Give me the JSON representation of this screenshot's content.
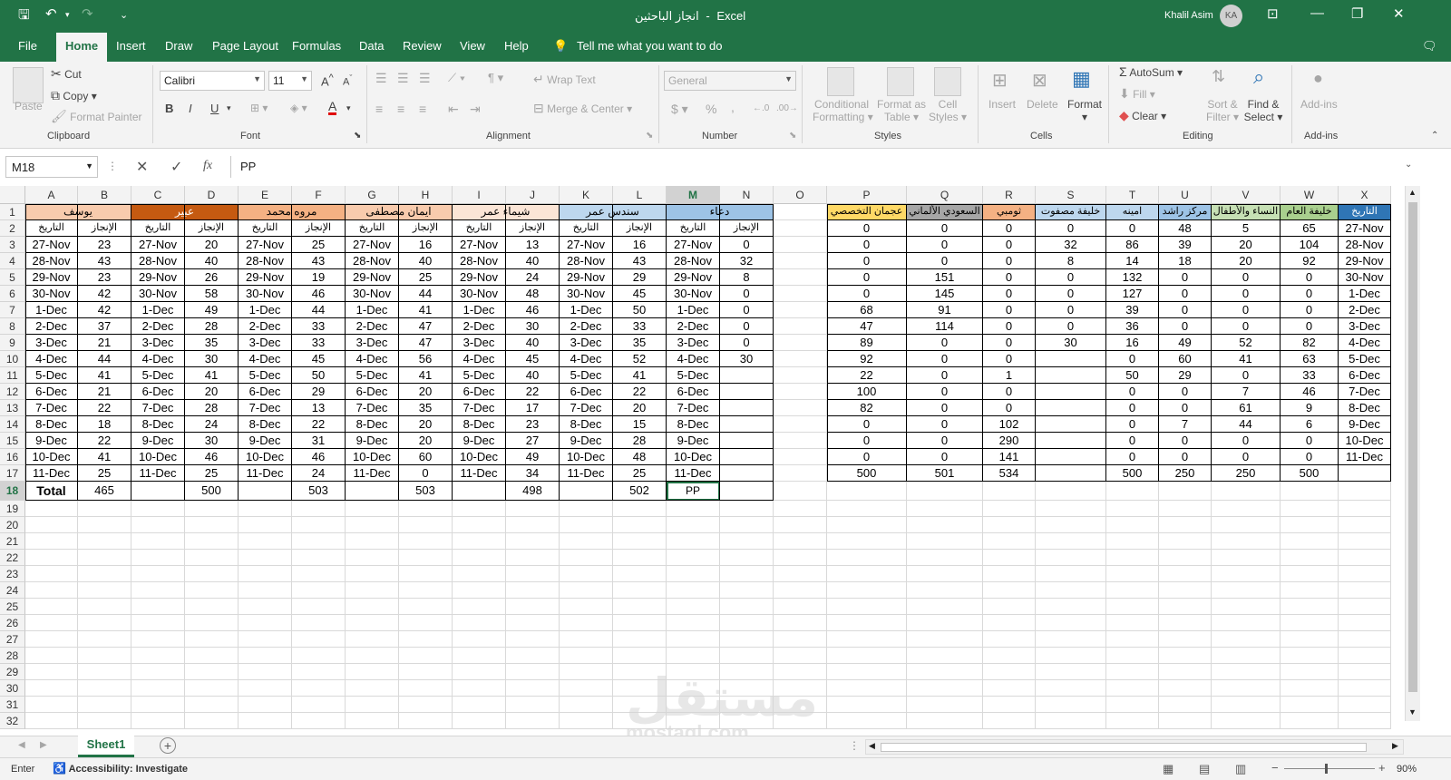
{
  "app": {
    "doc_title": "انجاز الباحثين",
    "separator": "-",
    "name": "Excel",
    "user_name": "Khalil Asim",
    "user_initials": "KA"
  },
  "tabs": [
    "File",
    "Home",
    "Insert",
    "Draw",
    "Page Layout",
    "Formulas",
    "Data",
    "Review",
    "View",
    "Help"
  ],
  "tell_me": "Tell me what you want to do",
  "ribbon": {
    "clipboard": {
      "paste": "Paste",
      "cut": "Cut",
      "copy": "Copy",
      "format_painter": "Format Painter",
      "label": "Clipboard"
    },
    "font": {
      "name": "Calibri",
      "size": "11",
      "bold": "B",
      "italic": "I",
      "underline": "U",
      "grow": "A",
      "shrink": "A",
      "color_a": "A",
      "label": "Font"
    },
    "alignment": {
      "wrap": "Wrap Text",
      "merge": "Merge & Center",
      "label": "Alignment"
    },
    "number": {
      "format": "General",
      "currency": "$",
      "percent": "%",
      "comma": ",",
      "label": "Number"
    },
    "styles": {
      "cond1": "Conditional",
      "cond2": "Formatting",
      "fmt1": "Format as",
      "fmt2": "Table",
      "cell1": "Cell",
      "cell2": "Styles",
      "label": "Styles"
    },
    "cells": {
      "insert": "Insert",
      "delete": "Delete",
      "format": "Format",
      "label": "Cells"
    },
    "editing": {
      "autosum": "AutoSum",
      "fill": "Fill",
      "clear": "Clear",
      "sort1": "Sort &",
      "sort2": "Filter",
      "find1": "Find &",
      "find2": "Select",
      "label": "Editing"
    },
    "addins": {
      "btn": "Add-ins",
      "label": "Add-ins"
    }
  },
  "formula": {
    "name_box": "M18",
    "fx": "fx",
    "content": "PP"
  },
  "sheet": {
    "columns": [
      "A",
      "B",
      "C",
      "D",
      "E",
      "F",
      "G",
      "H",
      "I",
      "J",
      "K",
      "L",
      "M",
      "N",
      "O",
      "P",
      "Q",
      "R",
      "S",
      "T",
      "U",
      "V",
      "W",
      "X"
    ],
    "rows": [
      "1",
      "2",
      "3",
      "4",
      "5",
      "6",
      "7",
      "8",
      "9",
      "10",
      "11",
      "12",
      "13",
      "14",
      "15",
      "16",
      "17",
      "18",
      "19",
      "20",
      "21",
      "22",
      "23",
      "24",
      "25",
      "26",
      "27",
      "28",
      "29",
      "30",
      "31",
      "32"
    ],
    "left_names": [
      "يوسف",
      "عبير",
      "مروه محمد",
      "ايمان مصطفى",
      "شيماء عمر",
      "سندس عمر",
      "دعاء"
    ],
    "left_name_colors": [
      "#f8cbad",
      "#c55a11",
      "#f4b183",
      "#f8cbad",
      "#fbe5d6",
      "#bdd7ee",
      "#9dc3e6"
    ],
    "sub_date": "التاريخ",
    "sub_ach": "الإنجاز",
    "dates": [
      "27-Nov",
      "28-Nov",
      "29-Nov",
      "30-Nov",
      "1-Dec",
      "2-Dec",
      "3-Dec",
      "4-Dec",
      "5-Dec",
      "6-Dec",
      "7-Dec",
      "8-Dec",
      "9-Dec",
      "10-Dec",
      "11-Dec"
    ],
    "left_values": [
      [
        "23",
        "43",
        "23",
        "42",
        "42",
        "37",
        "21",
        "44",
        "41",
        "21",
        "22",
        "18",
        "22",
        "41",
        "25"
      ],
      [
        "20",
        "40",
        "26",
        "58",
        "49",
        "28",
        "35",
        "30",
        "41",
        "20",
        "28",
        "24",
        "30",
        "46",
        "25"
      ],
      [
        "25",
        "43",
        "19",
        "46",
        "44",
        "33",
        "33",
        "45",
        "50",
        "29",
        "13",
        "22",
        "31",
        "46",
        "24"
      ],
      [
        "16",
        "40",
        "25",
        "44",
        "41",
        "47",
        "47",
        "56",
        "41",
        "20",
        "35",
        "20",
        "20",
        "60",
        "0"
      ],
      [
        "13",
        "40",
        "24",
        "48",
        "46",
        "30",
        "40",
        "45",
        "40",
        "22",
        "17",
        "23",
        "27",
        "49",
        "34"
      ],
      [
        "16",
        "43",
        "29",
        "45",
        "50",
        "33",
        "35",
        "52",
        "41",
        "22",
        "20",
        "15",
        "28",
        "48",
        "25"
      ],
      [
        "0",
        "32",
        "8",
        "0",
        "0",
        "0",
        "0",
        "30",
        "",
        "",
        "",
        "",
        "",
        "",
        ""
      ]
    ],
    "total_label": "Total",
    "totals": [
      "465",
      "500",
      "503",
      "503",
      "498",
      "502",
      "PP"
    ],
    "right_headers": [
      "عجمان التخصصي",
      "السعودي الألماني",
      "ثومبي",
      "خليفة مصفوت",
      "امينه",
      "مركز راشد",
      "النساء والأطفال",
      "خليفة العام",
      "التاريخ"
    ],
    "right_header_colors": [
      "#ffd966",
      "#a6a6a6",
      "#f4b183",
      "#bdd7ee",
      "#bdd7ee",
      "#9dc3e6",
      "#c6e0b4",
      "#a9d08e",
      "#2f75b5"
    ],
    "right_values": [
      [
        "0",
        "0",
        "0",
        "0",
        "0",
        "68",
        "47",
        "89",
        "92",
        "22",
        "100",
        "82",
        "0",
        "0",
        "0",
        "500"
      ],
      [
        "0",
        "0",
        "0",
        "151",
        "145",
        "91",
        "114",
        "0",
        "0",
        "0",
        "0",
        "0",
        "0",
        "0",
        "0",
        "501"
      ],
      [
        "0",
        "0",
        "0",
        "0",
        "0",
        "0",
        "0",
        "0",
        "0",
        "1",
        "0",
        "0",
        "102",
        "290",
        "141",
        "534"
      ],
      [
        "0",
        "32",
        "8",
        "0",
        "0",
        "0",
        "0",
        "30",
        "",
        "",
        "",
        "",
        "",
        "",
        "",
        ""
      ],
      [
        "0",
        "86",
        "14",
        "132",
        "127",
        "39",
        "36",
        "16",
        "0",
        "50",
        "0",
        "0",
        "0",
        "0",
        "0",
        "500"
      ],
      [
        "48",
        "39",
        "18",
        "0",
        "0",
        "0",
        "0",
        "49",
        "60",
        "29",
        "0",
        "0",
        "7",
        "0",
        "0",
        "250"
      ],
      [
        "5",
        "20",
        "20",
        "0",
        "0",
        "0",
        "0",
        "52",
        "41",
        "0",
        "7",
        "61",
        "44",
        "0",
        "0",
        "250"
      ],
      [
        "65",
        "104",
        "92",
        "0",
        "0",
        "0",
        "0",
        "82",
        "63",
        "33",
        "46",
        "9",
        "6",
        "0",
        "0",
        "500"
      ],
      [
        "27-Nov",
        "28-Nov",
        "29-Nov",
        "30-Nov",
        "1-Dec",
        "2-Dec",
        "3-Dec",
        "4-Dec",
        "5-Dec",
        "6-Dec",
        "7-Dec",
        "8-Dec",
        "9-Dec",
        "10-Dec",
        "11-Dec",
        ""
      ]
    ]
  },
  "sheet_tab": "Sheet1",
  "status": {
    "mode": "Enter",
    "accessibility": "Accessibility: Investigate",
    "zoom": "90%"
  },
  "watermark": {
    "ar": "مستقل",
    "en": "mostaql.com"
  }
}
